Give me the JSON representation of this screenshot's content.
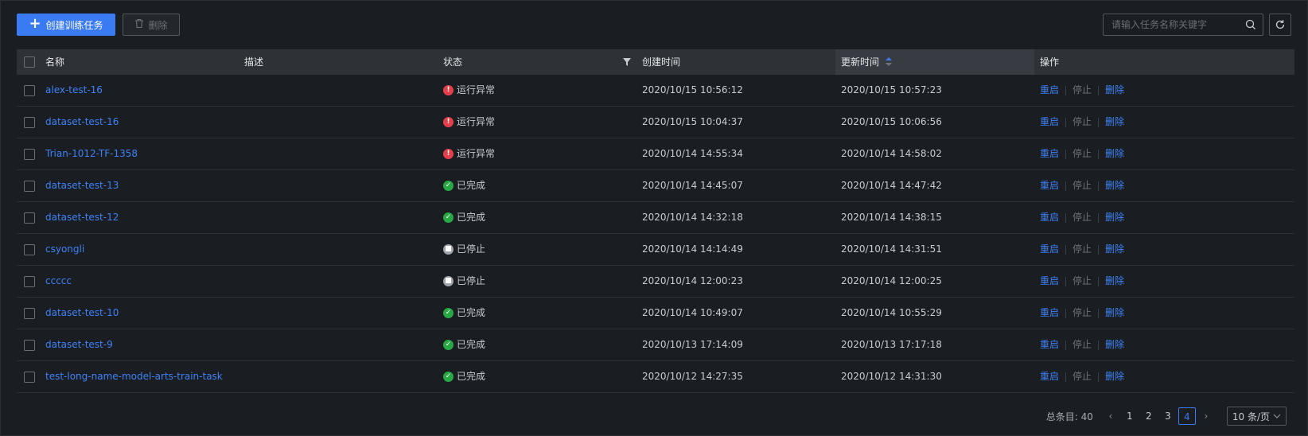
{
  "toolbar": {
    "create_label": "创建训练任务",
    "delete_label": "删除",
    "search_placeholder": "请输入任务名称关键字"
  },
  "table": {
    "columns": {
      "name": "名称",
      "desc": "描述",
      "status": "状态",
      "created": "创建时间",
      "updated": "更新时间",
      "actions": "操作"
    },
    "actions": {
      "restart": "重启",
      "stop": "停止",
      "delete": "删除"
    },
    "rows": [
      {
        "name": "alex-test-16",
        "status": "运行异常",
        "status_type": "error",
        "created": "2020/10/15 10:56:12",
        "updated": "2020/10/15 10:57:23"
      },
      {
        "name": "dataset-test-16",
        "status": "运行异常",
        "status_type": "error",
        "created": "2020/10/15 10:04:37",
        "updated": "2020/10/15 10:06:56"
      },
      {
        "name": "Trian-1012-TF-1358",
        "status": "运行异常",
        "status_type": "error",
        "created": "2020/10/14 14:55:34",
        "updated": "2020/10/14 14:58:02"
      },
      {
        "name": "dataset-test-13",
        "status": "已完成",
        "status_type": "done",
        "created": "2020/10/14 14:45:07",
        "updated": "2020/10/14 14:47:42"
      },
      {
        "name": "dataset-test-12",
        "status": "已完成",
        "status_type": "done",
        "created": "2020/10/14 14:32:18",
        "updated": "2020/10/14 14:38:15"
      },
      {
        "name": "csyongli",
        "status": "已停止",
        "status_type": "stopped",
        "created": "2020/10/14 14:14:49",
        "updated": "2020/10/14 14:31:51"
      },
      {
        "name": "ccccc",
        "status": "已停止",
        "status_type": "stopped",
        "created": "2020/10/14 12:00:23",
        "updated": "2020/10/14 12:00:25"
      },
      {
        "name": "dataset-test-10",
        "status": "已完成",
        "status_type": "done",
        "created": "2020/10/14 10:49:07",
        "updated": "2020/10/14 10:55:29"
      },
      {
        "name": "dataset-test-9",
        "status": "已完成",
        "status_type": "done",
        "created": "2020/10/13 17:14:09",
        "updated": "2020/10/13 17:17:18"
      },
      {
        "name": "test-long-name-model-arts-train-task",
        "status": "已完成",
        "status_type": "done",
        "created": "2020/10/12 14:27:35",
        "updated": "2020/10/12 14:31:30"
      }
    ]
  },
  "pagination": {
    "total_label": "总条目: 40",
    "pages": [
      "1",
      "2",
      "3",
      "4"
    ],
    "current_page": "4",
    "page_size_label": "10 条/页"
  },
  "colors": {
    "accent": "#3a7af2",
    "link": "#3f82f7",
    "error": "#e5404a",
    "success": "#28a745",
    "stopped": "#a0a4aa",
    "background": "#1a1d21"
  }
}
